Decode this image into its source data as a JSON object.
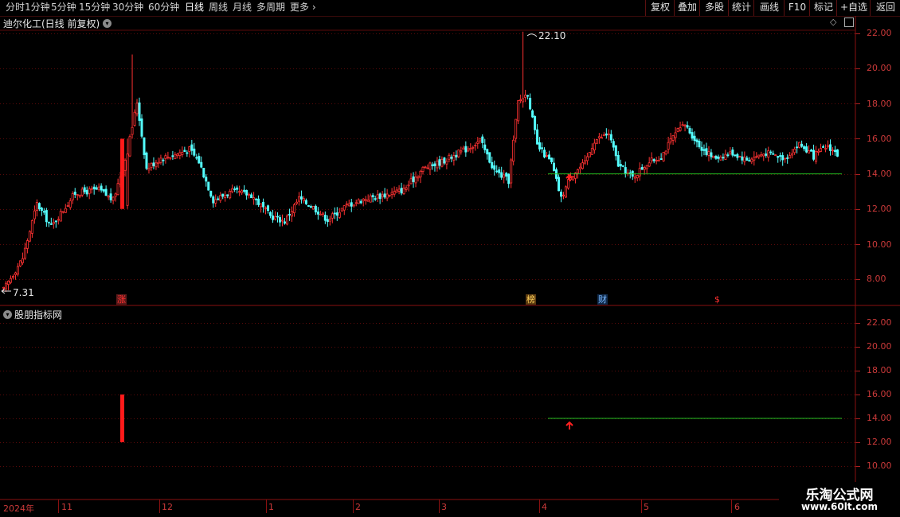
{
  "toolbar": {
    "left": [
      {
        "label": "分时",
        "active": false
      },
      {
        "label": "1分钟",
        "active": false
      },
      {
        "label": "5分钟",
        "active": false
      },
      {
        "label": "15分钟",
        "active": false
      },
      {
        "label": "30分钟",
        "active": false
      },
      {
        "label": "60分钟",
        "active": false
      },
      {
        "label": "日线",
        "active": true
      },
      {
        "label": "周线",
        "active": false
      },
      {
        "label": "月线",
        "active": false
      },
      {
        "label": "多周期",
        "active": false
      },
      {
        "label": "更多",
        "active": false
      }
    ],
    "right": [
      "复权",
      "叠加",
      "多股",
      "统计",
      "画线",
      "F10",
      "标记",
      "+自选",
      "返回"
    ]
  },
  "main_chart": {
    "title": "迪尔化工(日线 前复权)",
    "max_label": "22.10",
    "min_label": "7.31",
    "y_ticks": [
      "22.00",
      "20.00",
      "18.00",
      "16.00",
      "14.00",
      "12.00",
      "10.00",
      "8.00"
    ],
    "events": [
      {
        "label": "涨",
        "color": "#ff3030",
        "bg": "#5a1a1a"
      },
      {
        "label": "榜",
        "color": "#ffd25a",
        "bg": "#5a3a10"
      },
      {
        "label": "财",
        "color": "#7ab8ff",
        "bg": "#102a4a"
      },
      {
        "label": "$",
        "color": "#ff3030",
        "bg": "#000000"
      }
    ]
  },
  "indicator": {
    "title": "股朋指标网",
    "y_ticks": [
      "22.00",
      "20.00",
      "18.00",
      "16.00",
      "14.00",
      "12.00",
      "10.00"
    ]
  },
  "x_axis": [
    "2024年",
    "11",
    "12",
    "1",
    "2",
    "3",
    "4",
    "5",
    "6"
  ],
  "colors": {
    "up": "#ff3232",
    "down": "#54ffff",
    "grid": "#5a0a0a",
    "support": "#22c022",
    "axis_text": "#cc3a3a"
  },
  "watermark": {
    "line1": "乐淘公式网",
    "line2": "www.60lt.com"
  }
}
